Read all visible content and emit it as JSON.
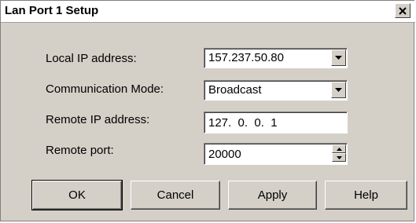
{
  "window": {
    "title": "Lan Port 1 Setup"
  },
  "form": {
    "local_ip": {
      "label": "Local IP address:",
      "value": "157.237.50.80"
    },
    "comm_mode": {
      "label": "Communication Mode:",
      "value": "Broadcast"
    },
    "remote_ip": {
      "label": "Remote IP address:",
      "value": "127.  0.  0.  1"
    },
    "remote_port": {
      "label": "Remote port:",
      "value": "20000"
    }
  },
  "buttons": {
    "ok": "OK",
    "cancel": "Cancel",
    "apply": "Apply",
    "help": "Help"
  },
  "icons": {
    "close": "close-icon",
    "dropdown": "chevron-down-icon",
    "spin_up": "spin-up-icon",
    "spin_down": "spin-down-icon"
  },
  "colors": {
    "dialog_bg": "#d4d0c8",
    "title_bg": "#ffffff"
  }
}
